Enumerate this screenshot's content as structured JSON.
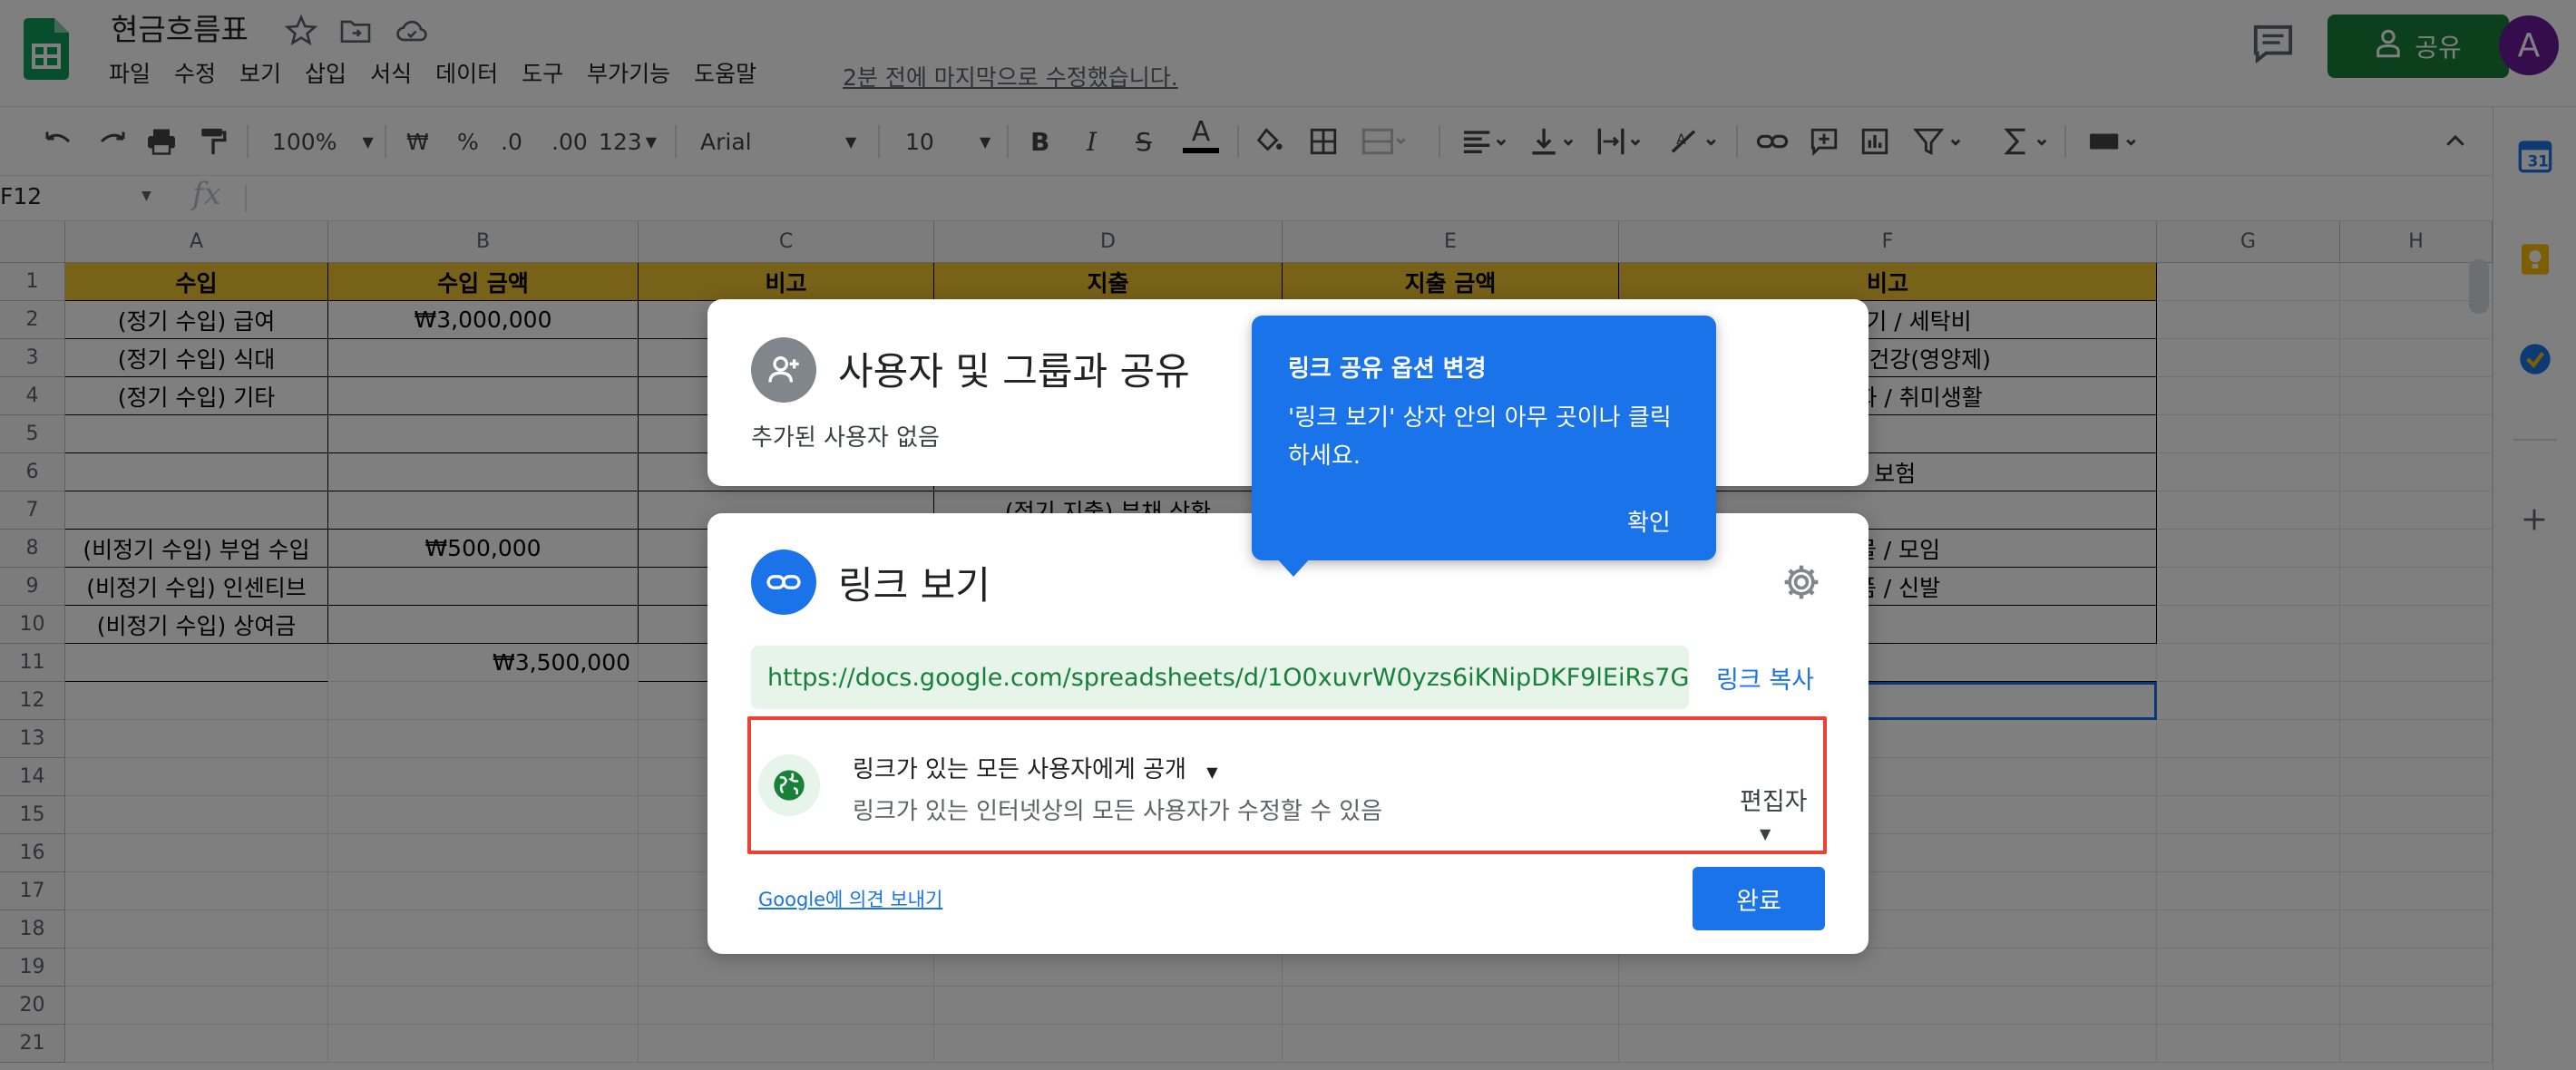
{
  "header": {
    "doc_title": "현금흐름표",
    "menu": [
      "파일",
      "수정",
      "보기",
      "삽입",
      "서식",
      "데이터",
      "도구",
      "부가기능",
      "도움말"
    ],
    "last_edit": "2분 전에 마지막으로 수정했습니다.",
    "share_label": "공유",
    "avatar_letter": "A"
  },
  "toolbar": {
    "zoom": "100%",
    "currency": "₩",
    "percent": "%",
    "dec_less": ".0",
    "dec_more": ".00",
    "more_formats": "123",
    "font": "Arial",
    "font_size": "10",
    "bold": "B",
    "italic": "I",
    "strike": "S",
    "text_color": "A"
  },
  "formula_bar": {
    "cell_ref": "F12",
    "fx": "fx"
  },
  "grid": {
    "columns": [
      "A",
      "B",
      "C",
      "D",
      "E",
      "F",
      "G",
      "H"
    ],
    "rows": [
      "1",
      "2",
      "3",
      "4",
      "5",
      "6",
      "7",
      "8",
      "9",
      "10",
      "11",
      "12",
      "13",
      "14",
      "15",
      "16",
      "17",
      "18",
      "19",
      "20",
      "21"
    ],
    "header_row": [
      "수입",
      "수입 금액",
      "비고",
      "지출",
      "지출 금액",
      "비고"
    ],
    "col_a": [
      "",
      "(정기 수입) 급여",
      "(정기 수입) 식대",
      "(정기 수입) 기타",
      "",
      "",
      "",
      "(비정기 수입) 부업 수입",
      "(비정기 수입) 인센티브",
      "(비정기 수입) 상여금",
      ""
    ],
    "col_b": [
      "",
      "₩3,000,000",
      "",
      "",
      "",
      "",
      "",
      "₩500,000",
      "",
      "",
      "₩3,500,000"
    ],
    "col_d_row7": "(정기 지출) 부채 상환",
    "col_f": [
      "",
      "가스전기 / 세탁비",
      "생활비 / 건강(영양제)",
      "책 / 영화 / 취미생활",
      "",
      "/ 보험",
      "",
      "선물 / 모임",
      "장품 / 신발",
      "",
      ""
    ]
  },
  "share_dialog": {
    "people_title": "사용자 및 그룹과 공유",
    "people_sub": "추가된 사용자 없음",
    "link_title": "링크 보기",
    "url": "https://docs.google.com/spreadsheets/d/1O0xuvrW0yzs6iKNipDKF9lEiRs7G...",
    "copy_link": "링크 복사",
    "access_main": "링크가 있는 모든 사용자에게 공개",
    "access_desc": "링크가 있는 인터넷상의 모든 사용자가 수정할 수 있음",
    "role": "편집자",
    "feedback": "Google에 의견 보내기",
    "done": "완료"
  },
  "tooltip": {
    "title": "링크 공유 옵션 변경",
    "body": "'링크 보기' 상자 안의 아무 곳이나 클릭하세요.",
    "ok": "확인"
  },
  "colors": {
    "share_green": "#188038",
    "accent_blue": "#1a73e8",
    "header_fill": "#f1c232",
    "highlight_red": "#ea4335",
    "avatar_purple": "#6a1b9a"
  },
  "icons": [
    "sheets-logo-icon",
    "star-icon",
    "move-folder-icon",
    "cloud-status-icon",
    "comment-icon",
    "person-share-icon",
    "undo-icon",
    "redo-icon",
    "print-icon",
    "paint-format-icon",
    "fill-color-icon",
    "borders-icon",
    "merge-icon",
    "align-icon",
    "valign-icon",
    "wrap-icon",
    "rotate-icon",
    "link-icon",
    "insert-comment-icon",
    "insert-chart-icon",
    "filter-icon",
    "functions-icon",
    "input-tools-icon",
    "collapse-icon",
    "calendar-icon",
    "keep-icon",
    "tasks-icon",
    "add-icon",
    "add-person-icon",
    "gear-icon",
    "globe-icon"
  ]
}
